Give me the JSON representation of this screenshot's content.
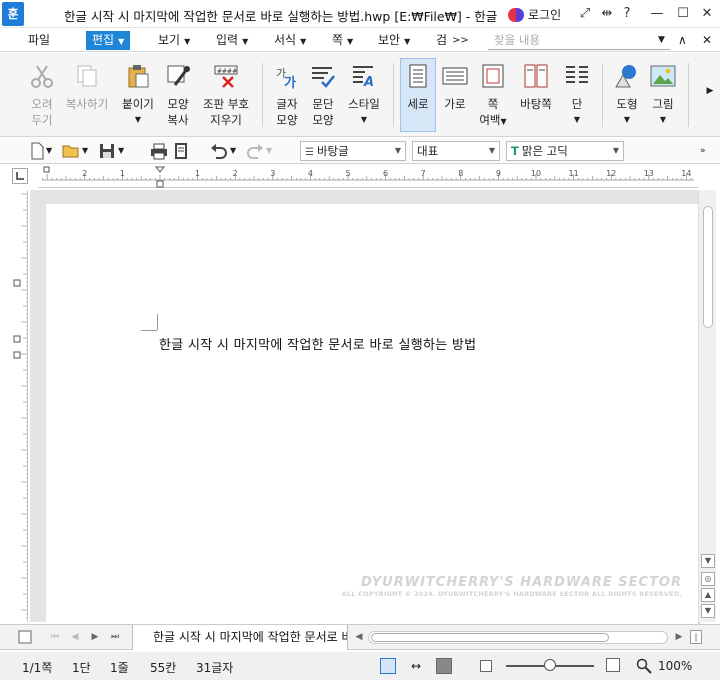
{
  "window": {
    "title": "한글 시작 시 마지막에 작업한 문서로 바로 실행하는 방법.hwp [E:₩File₩] - 한글",
    "app_icon": "훈",
    "login_label": "로그인"
  },
  "menu": {
    "items": [
      "파일",
      "편집",
      "보기",
      "입력",
      "서식",
      "쪽",
      "보안",
      "검"
    ],
    "active": "편집",
    "more": ">>",
    "find_placeholder": "찾을 내용"
  },
  "ribbon": {
    "buttons": [
      {
        "label": "오려",
        "label2": "두기",
        "icon": "scissors-icon",
        "disabled": true
      },
      {
        "label": "복사하기",
        "label2": "",
        "icon": "copy-icon",
        "disabled": true
      },
      {
        "label": "붙이기",
        "label2": "",
        "icon": "paste-icon",
        "disabled": false
      },
      {
        "label": "모양",
        "label2": "복사",
        "icon": "format-painter-icon",
        "disabled": false
      },
      {
        "label": "조판 부호",
        "label2": "지우기",
        "icon": "clear-markup-icon",
        "disabled": false
      },
      {
        "label": "글자",
        "label2": "모양",
        "icon": "char-shape-icon",
        "disabled": false
      },
      {
        "label": "문단",
        "label2": "모양",
        "icon": "para-shape-icon",
        "disabled": false
      },
      {
        "label": "스타일",
        "label2": "",
        "icon": "style-icon",
        "disabled": false
      },
      {
        "label": "세로",
        "label2": "",
        "icon": "portrait-icon",
        "disabled": false
      },
      {
        "label": "가로",
        "label2": "",
        "icon": "landscape-icon",
        "disabled": false
      },
      {
        "label": "쪽",
        "label2": "여백",
        "icon": "margin-icon",
        "disabled": false
      },
      {
        "label": "바탕쪽",
        "label2": "",
        "icon": "master-page-icon",
        "disabled": false
      },
      {
        "label": "단",
        "label2": "",
        "icon": "columns-icon",
        "disabled": false
      },
      {
        "label": "도형",
        "label2": "",
        "icon": "shape-icon",
        "disabled": false
      },
      {
        "label": "그림",
        "label2": "",
        "icon": "picture-icon",
        "disabled": false
      }
    ]
  },
  "toolbar": {
    "style_combo": "바탕글",
    "para_combo": "대표",
    "font_combo": "맑은 고딕"
  },
  "ruler": {
    "numbers": [
      "2",
      "1",
      "1",
      "2",
      "3",
      "4",
      "5",
      "6",
      "7",
      "8",
      "9",
      "10",
      "11",
      "12",
      "13",
      "14"
    ]
  },
  "document": {
    "text": "한글 시작 시 마지막에 작업한 문서로 바로 실행하는 방법",
    "watermark_line1": "DYURWITCHERRY'S HARDWARE SECTOR",
    "watermark_line2": "ALL COPYRIGHT © 2024. DYURWITCHERRY'S HARDWARE SECTOR ALL RIGHTS RESERVED."
  },
  "tab": {
    "doc_name": "한글 시작 시 마지막에 작업한 문서로 바로 실행하는 방법"
  },
  "status": {
    "page": "1/1쪽",
    "column": "1단",
    "line": "1줄",
    "char_pos": "55칸",
    "char_count": "31글자",
    "zoom": "100%"
  },
  "colors": {
    "accent": "#1f85d6",
    "app_icon_bg": "#1f7cd8"
  }
}
